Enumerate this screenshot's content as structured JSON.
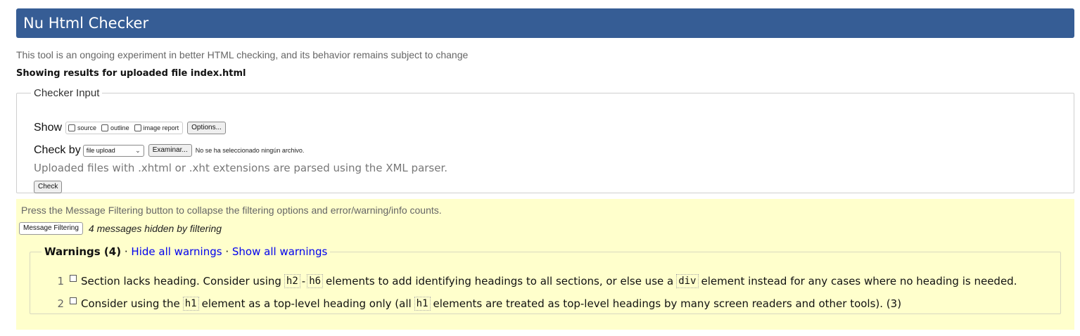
{
  "header": {
    "title": "Nu Html Checker"
  },
  "intro": "This tool is an ongoing experiment in better HTML checking, and its behavior remains subject to change",
  "showing": "Showing results for uploaded file index.html",
  "checker_input": {
    "legend": "Checker Input",
    "show_label": "Show",
    "show_options": [
      "source",
      "outline",
      "image report"
    ],
    "options_button": "Options...",
    "check_by_label": "Check by",
    "check_by_value": "file upload",
    "browse_button": "Examinar...",
    "no_file": "No se ha seleccionado ningún archivo.",
    "note": "Uploaded files with .xhtml or .xht extensions are parsed using the XML parser.",
    "check_button": "Check"
  },
  "filtering": {
    "hint": "Press the Message Filtering button to collapse the filtering options and error/warning/info counts.",
    "button": "Message Filtering",
    "hidden_count_text": "4 messages hidden by filtering"
  },
  "warnings": {
    "title": "Warnings (4)",
    "separator": "·",
    "hide_all": "Hide all warnings",
    "show_all": "Show all warnings",
    "messages": [
      {
        "number": "1",
        "text_a": "Section lacks heading. Consider using",
        "code_a": "h2",
        "dash": "-",
        "code_b": "h6",
        "text_b": "elements to add identifying headings to all sections, or else use a",
        "code_c": "div",
        "text_c": "element instead for any cases where no heading is needed."
      },
      {
        "number": "2",
        "text_a": "Consider using the",
        "code_a": "h1",
        "text_b": "element as a top-level heading only (all",
        "code_b": "h1",
        "text_c": "elements are treated as top-level headings by many screen readers and other tools). (3)"
      }
    ]
  }
}
